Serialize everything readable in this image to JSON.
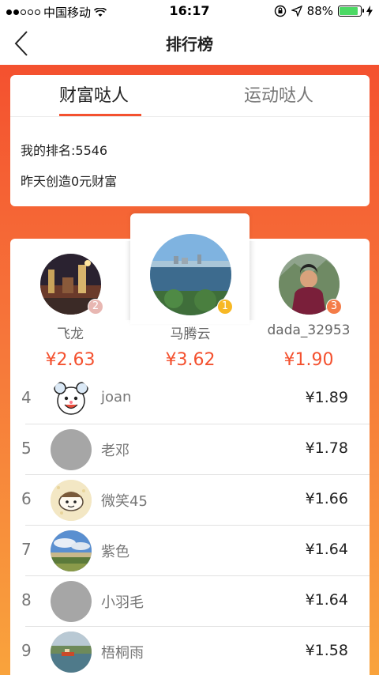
{
  "status_bar": {
    "carrier": "中国移动",
    "time": "16:17",
    "battery": "88%",
    "battery_level": 0.88
  },
  "nav": {
    "title": "排行榜"
  },
  "tabs": [
    {
      "label": "财富哒人",
      "active": true
    },
    {
      "label": "运动哒人",
      "active": false
    }
  ],
  "summary": {
    "my_rank": "我的排名:5546",
    "yesterday": "昨天创造0元财富"
  },
  "podium": [
    {
      "rank": "2",
      "name": "飞龙",
      "amount": "¥2.63"
    },
    {
      "rank": "1",
      "name": "马腾云",
      "amount": "¥3.62"
    },
    {
      "rank": "3",
      "name": "dada_32953",
      "amount": "¥1.90"
    }
  ],
  "ranking": [
    {
      "rank": "4",
      "name": "joan",
      "amount": "¥1.89"
    },
    {
      "rank": "5",
      "name": "老邓",
      "amount": "¥1.78"
    },
    {
      "rank": "6",
      "name": "微笑45",
      "amount": "¥1.66"
    },
    {
      "rank": "7",
      "name": "紫色",
      "amount": "¥1.64"
    },
    {
      "rank": "8",
      "name": "小羽毛",
      "amount": "¥1.64"
    },
    {
      "rank": "9",
      "name": "梧桐雨",
      "amount": "¥1.58"
    }
  ],
  "colors": {
    "accent": "#f4512f",
    "gradient_bottom": "#f9a33c"
  }
}
